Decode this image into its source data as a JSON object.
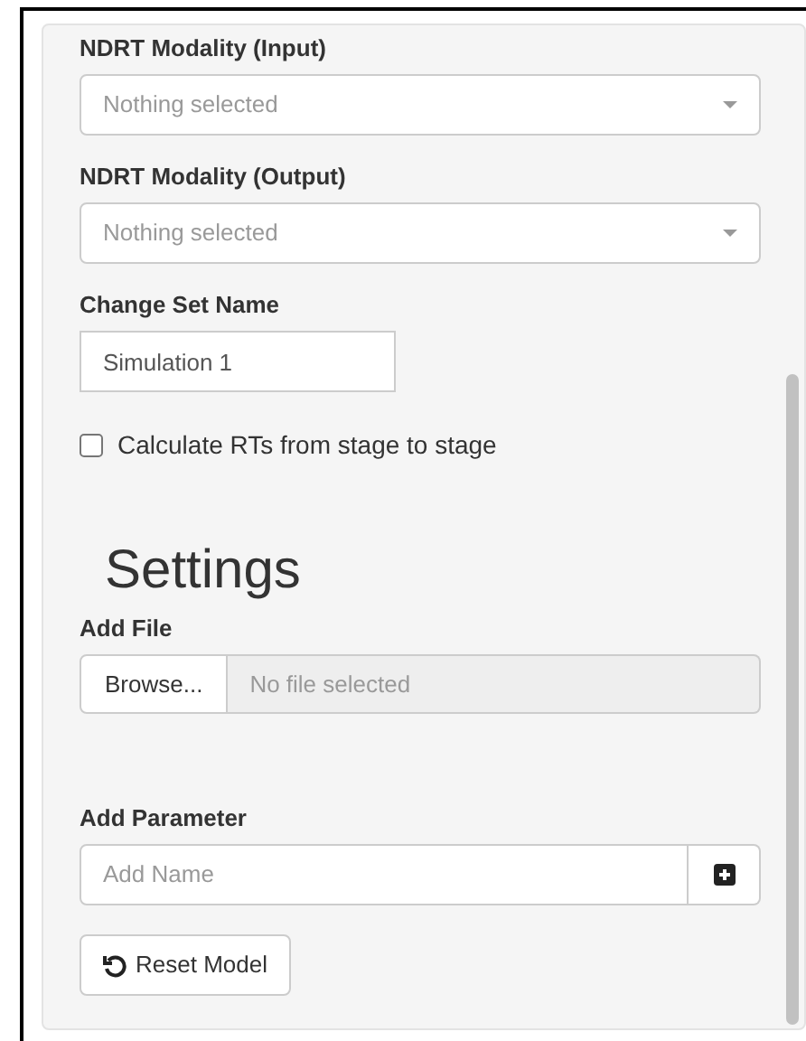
{
  "selects": [
    {
      "label": "NDRT Modality (Input)",
      "placeholder": "Nothing selected"
    },
    {
      "label": "NDRT Modality (Output)",
      "placeholder": "Nothing selected"
    }
  ],
  "set_name": {
    "label": "Change Set Name",
    "value": "Simulation 1"
  },
  "checkbox": {
    "label": "Calculate RTs from stage to stage",
    "checked": false
  },
  "heading": "Settings",
  "add_file": {
    "label": "Add File",
    "button": "Browse...",
    "placeholder": "No file selected"
  },
  "add_parameter": {
    "label": "Add Parameter",
    "placeholder": "Add Name"
  },
  "reset_button": "Reset Model"
}
